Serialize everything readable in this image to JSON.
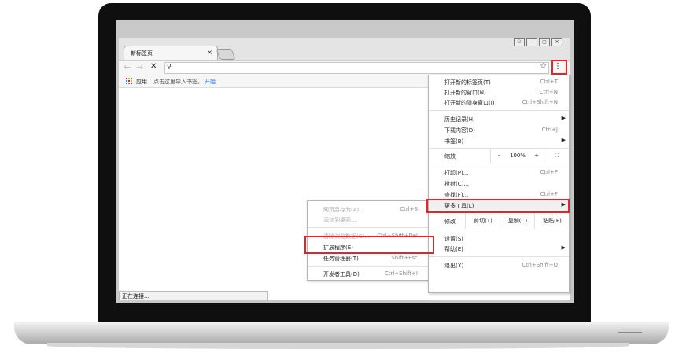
{
  "tab": {
    "title": "新标签页",
    "close": "×"
  },
  "toolbar": {
    "back": "←",
    "forward": "→",
    "stop": "✕",
    "search_glyph": "⚲",
    "star": "☆",
    "menu": "⋮"
  },
  "window_controls": [
    "⚇",
    "–",
    "▢",
    "✕"
  ],
  "bookmarks": {
    "apps": "应用",
    "hint": "点击这里导入书签。",
    "start": "开始"
  },
  "status": "正在连接...",
  "main_menu": {
    "new_tab": {
      "label": "打开新的标签页(T)",
      "shortcut": "Ctrl+T"
    },
    "new_window": {
      "label": "打开新的窗口(N)",
      "shortcut": "Ctrl+N"
    },
    "incognito": {
      "label": "打开新的隐身窗口(I)",
      "shortcut": "Ctrl+Shift+N"
    },
    "history": {
      "label": "历史记录(H)"
    },
    "downloads": {
      "label": "下载内容(D)",
      "shortcut": "Ctrl+J"
    },
    "bookmarks": {
      "label": "书签(B)"
    },
    "zoom": {
      "label": "缩放",
      "minus": "-",
      "value": "100%",
      "plus": "+",
      "fullscreen": "⛶"
    },
    "print": {
      "label": "打印(P)...",
      "shortcut": "Ctrl+P"
    },
    "cast": {
      "label": "投射(C)..."
    },
    "find": {
      "label": "查找(F)...",
      "shortcut": "Ctrl+F"
    },
    "more_tools": {
      "label": "更多工具(L)"
    },
    "edit": {
      "label": "修改",
      "cut": "剪切(T)",
      "copy": "复制(C)",
      "paste": "粘贴(P)"
    },
    "settings": {
      "label": "设置(S)"
    },
    "help": {
      "label": "帮助(E)"
    },
    "exit": {
      "label": "退出(X)",
      "shortcut": "Ctrl+Shift+Q"
    }
  },
  "sub_menu": {
    "save_page": {
      "label": "网页另存为(A)...",
      "shortcut": "Ctrl+S"
    },
    "add_desktop": {
      "label": "添加到桌面..."
    },
    "clear_data": {
      "label": "清除浏览数据(C)...",
      "shortcut": "Ctrl+Shift+Del"
    },
    "extensions": {
      "label": "扩展程序(E)"
    },
    "task_manager": {
      "label": "任务管理器(T)",
      "shortcut": "Shift+Esc"
    },
    "dev_tools": {
      "label": "开发者工具(D)",
      "shortcut": "Ctrl+Shift+I"
    }
  },
  "colors": {
    "highlight": "#e0262b",
    "link": "#1a73e8"
  }
}
